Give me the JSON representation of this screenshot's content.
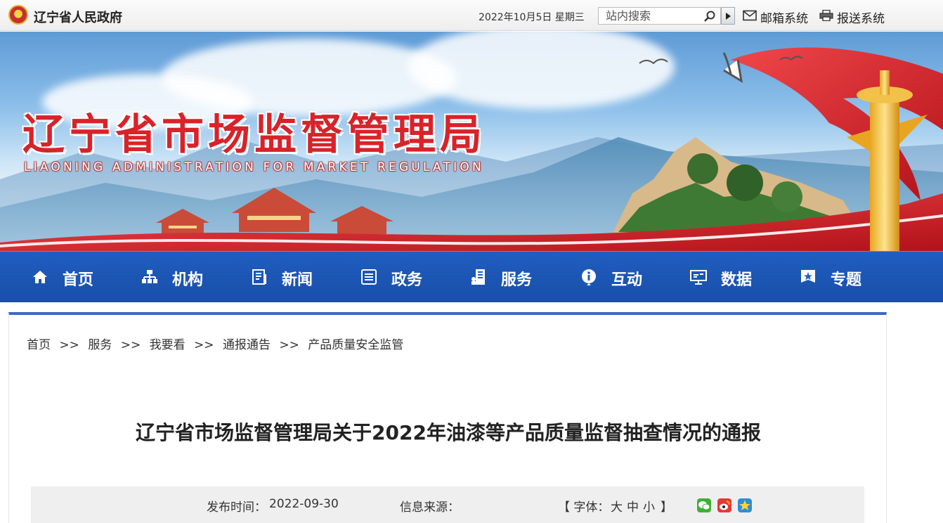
{
  "topbar": {
    "site_name": "辽宁省人民政府",
    "date": "2022年10月5日 星期三",
    "search_placeholder": "站内搜索",
    "links": [
      {
        "label": "邮箱系统",
        "icon": "mail-icon"
      },
      {
        "label": "报送系统",
        "icon": "printer-icon"
      }
    ]
  },
  "banner": {
    "title": "辽宁省市场监督管理局",
    "subtitle": "LIAONING ADMINISTRATION FOR MARKET REGULATION"
  },
  "nav": {
    "items": [
      {
        "label": "首页",
        "icon": "home-icon"
      },
      {
        "label": "机构",
        "icon": "org-chart-icon"
      },
      {
        "label": "新闻",
        "icon": "news-icon"
      },
      {
        "label": "政务",
        "icon": "list-icon"
      },
      {
        "label": "服务",
        "icon": "service-icon"
      },
      {
        "label": "互动",
        "icon": "info-icon"
      },
      {
        "label": "数据",
        "icon": "data-screen-icon"
      },
      {
        "label": "专题",
        "icon": "star-flag-icon"
      }
    ]
  },
  "breadcrumb": {
    "items": [
      "首页",
      "服务",
      "我要看",
      "通报通告",
      "产品质量安全监管"
    ],
    "separator": ">>"
  },
  "article": {
    "title": "辽宁省市场监督管理局关于2022年油漆等产品质量监督抽查情况的通报",
    "publish_label": "发布时间：",
    "publish_date": "2022-09-30",
    "source_label": "信息来源：",
    "font_size_open": "【 字体：",
    "font_large": "大",
    "font_medium": "中",
    "font_small": "小",
    "font_size_close": "】"
  },
  "colors": {
    "nav_bg": "#1f5ec1",
    "banner_title": "#d8232a",
    "accent_border": "#3a67c9"
  }
}
